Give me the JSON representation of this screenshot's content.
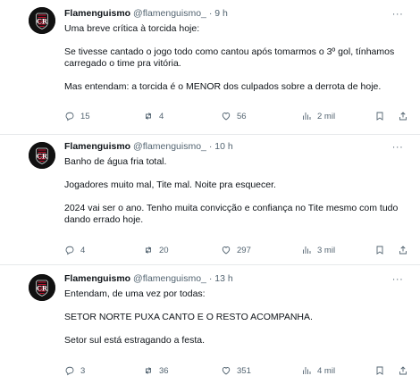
{
  "tweets": [
    {
      "name": "Flamenguismo",
      "handle": "@flamenguismo_",
      "dot": "·",
      "time": "9 h",
      "text": "Uma breve crítica à torcida hoje:\n\nSe tivesse cantado o jogo todo como cantou após tomarmos o 3º gol, tínhamos carregado o time pra vitória.\n\nMas entendam: a torcida é o MENOR dos culpados sobre a derrota de hoje.",
      "replies": "15",
      "retweets": "4",
      "likes": "56",
      "views": "2 mil"
    },
    {
      "name": "Flamenguismo",
      "handle": "@flamenguismo_",
      "dot": "·",
      "time": "10 h",
      "text": "Banho de água fria total.\n\nJogadores muito mal, Tite mal. Noite pra esquecer.\n\n2024 vai ser o ano. Tenho muita convicção e confiança no Tite mesmo com tudo dando errado hoje.",
      "replies": "4",
      "retweets": "20",
      "likes": "297",
      "views": "3 mil"
    },
    {
      "name": "Flamenguismo",
      "handle": "@flamenguismo_",
      "dot": "·",
      "time": "13 h",
      "text": "Entendam, de uma vez por todas:\n\nSETOR NORTE PUXA CANTO E O RESTO ACOMPANHA.\n\nSetor sul está estragando a festa.",
      "replies": "3",
      "retweets": "36",
      "likes": "351",
      "views": "4 mil"
    }
  ],
  "icons": {
    "more": "more-icon",
    "reply": "reply-icon",
    "retweet": "retweet-icon",
    "like": "heart-icon",
    "views": "views-icon",
    "bookmark": "bookmark-icon",
    "share": "share-icon"
  },
  "colors": {
    "text": "#0f1419",
    "secondary": "#536471",
    "divider": "#e6e9eb",
    "avatar_bg": "#111111",
    "avatar_red": "#c8102e"
  }
}
